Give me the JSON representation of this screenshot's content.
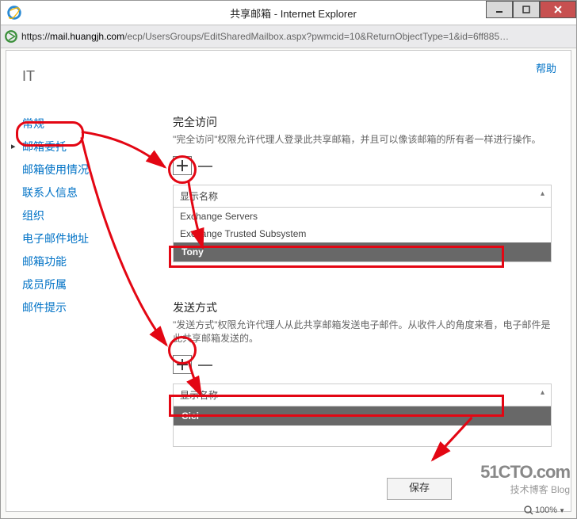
{
  "window": {
    "title": "共享邮箱 - Internet Explorer",
    "url_scheme": "https://",
    "url_host": "mail.huangjh.com",
    "url_path": "/ecp/UsersGroups/EditSharedMailbox.aspx?pwmcid=10&ReturnObjectType=1&id=6ff885…"
  },
  "page": {
    "help": "帮助",
    "title": "IT"
  },
  "nav": {
    "items": [
      "常规",
      "邮箱委托",
      "邮箱使用情况",
      "联系人信息",
      "组织",
      "电子邮件地址",
      "邮箱功能",
      "成员所属",
      "邮件提示"
    ],
    "selected_index": 1
  },
  "fullaccess": {
    "title": "完全访问",
    "desc": "\"完全访问\"权限允许代理人登录此共享邮箱，并且可以像该邮箱的所有者一样进行操作。",
    "add_icon": "＋",
    "remove_icon": "—",
    "header": "显示名称",
    "rows": [
      "Exchange Servers",
      "Exchange Trusted Subsystem"
    ],
    "highlight": "Tony"
  },
  "sendas": {
    "title": "发送方式",
    "desc": "\"发送方式\"权限允许代理人从此共享邮箱发送电子邮件。从收件人的角度来看，电子邮件是此共享邮箱发送的。",
    "add_icon": "＋",
    "remove_icon": "—",
    "header": "显示名称",
    "highlight": "Cici"
  },
  "footer": {
    "save": "保存"
  },
  "zoom": {
    "value": "100%"
  },
  "watermark": {
    "line1": "51CTO.com",
    "line2": "技术博客   Blog"
  }
}
